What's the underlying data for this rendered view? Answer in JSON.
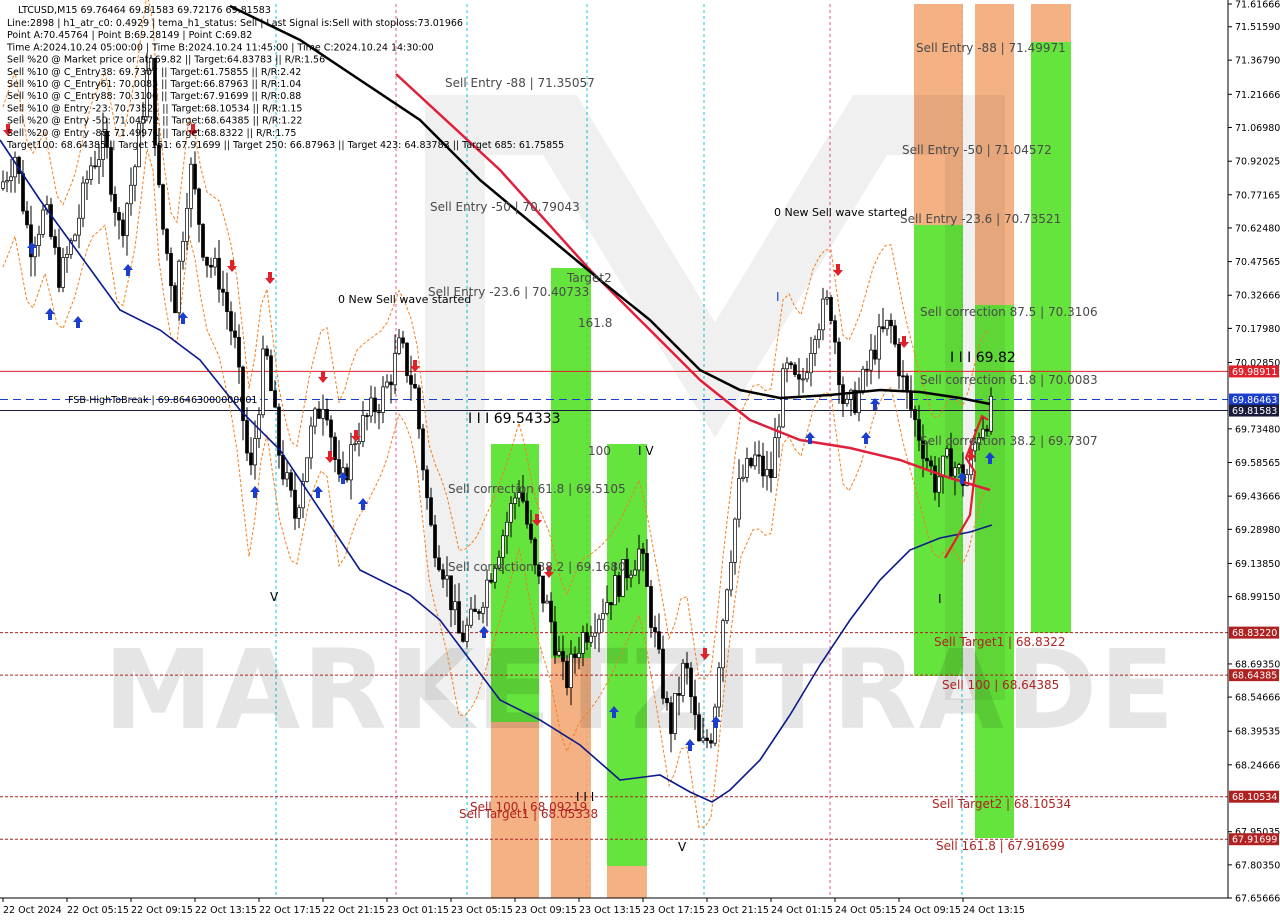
{
  "window": {
    "symbol_line": "LTCUSD,M15  69.76464 69.81583 69.72176 69.81583"
  },
  "info_lines": [
    "Line:2898 | h1_atr_c0: 0.4929 | tema_h1_status: Sell | Last Signal is:Sell with stoploss:73.01966",
    "Point A:70.45764 | Point B:69.28149 | Point C:69.82",
    "Time A:2024.10.24 05:00:00 | Time B:2024.10.24 11:45:00 | Time C:2024.10.24 14:30:00",
    "Sell %20 @ Market price or at: 69.82 || Target:64.83783 || R/R:1.56",
    "Sell %10 @ C_Entry38: 69.7307 || Target:61.75855 || R/R:2.42",
    "Sell %10 @ C_Entry61: 70.0083 || Target:66.87963 || R/R:1.04",
    "Sell %10 @ C_Entry88: 70.3106 || Target:67.91699 || R/R:0.88",
    "Sell %10 @ Entry -23: 70.73521 || Target:68.10534 || R/R:1.15",
    "Sell %20 @ Entry -50: 71.04572 || Target:68.64385 || R/R:1.22",
    "Sell %20 @ Entry -88: 71.49971 || Target:68.8322 || R/R:1.75",
    "Target100: 68.64385 || Target 161: 67.91699 || Target 250: 66.87963 || Target 423: 64.83783 || Target 685: 61.75855"
  ],
  "watermark": "MARKETZITRADE",
  "chart_data": {
    "type": "candlestick",
    "ylim": [
      67.65666,
      71.61666
    ],
    "x_ticks": [
      "22 Oct 2024",
      "22 Oct 05:15",
      "22 Oct 09:15",
      "22 Oct 13:15",
      "22 Oct 17:15",
      "22 Oct 21:15",
      "23 Oct 01:15",
      "23 Oct 05:15",
      "23 Oct 09:15",
      "23 Oct 13:15",
      "23 Oct 17:15",
      "23 Oct 21:15",
      "24 Oct 01:15",
      "24 Oct 05:15",
      "24 Oct 09:15",
      "24 Oct 13:15"
    ],
    "y_ticks": [
      71.61666,
      71.5159,
      71.3679,
      71.21666,
      71.0698,
      70.92025,
      70.77165,
      70.6248,
      70.47565,
      70.32666,
      70.1798,
      70.0285,
      69.7348,
      69.58565,
      69.43666,
      69.2898,
      69.1385,
      68.9915,
      68.6935,
      68.54666,
      68.39535,
      68.24666,
      67.95035,
      67.8035,
      67.65666
    ],
    "price_labels": [
      {
        "text": "69.98911",
        "value": 69.98911,
        "color": "#e0202a"
      },
      {
        "text": "69.86463",
        "value": 69.86463,
        "color": "#1a3fd0"
      },
      {
        "text": "69.81583",
        "value": 69.81583,
        "color": "#1a1a3a"
      },
      {
        "text": "68.83220",
        "value": 68.8322,
        "color": "#b02222"
      },
      {
        "text": "68.64385",
        "value": 68.64385,
        "color": "#b02222"
      },
      {
        "text": "68.10534",
        "value": 68.10534,
        "color": "#b02222"
      },
      {
        "text": "67.91699",
        "value": 67.91699,
        "color": "#b02222"
      }
    ],
    "horizontal_lines": [
      {
        "value": 69.98911,
        "color": "#e0202a",
        "style": "solid"
      },
      {
        "value": 69.86463,
        "color": "#1a3fd0",
        "style": "dashed"
      },
      {
        "value": 69.81583,
        "color": "#1a1a3a",
        "style": "solid"
      },
      {
        "value": 68.8322,
        "color": "#b02222",
        "style": "dotted"
      },
      {
        "value": 68.64385,
        "color": "#b02222",
        "style": "dotted"
      },
      {
        "value": 68.10534,
        "color": "#b02222",
        "style": "dotted"
      },
      {
        "value": 67.91699,
        "color": "#b02222",
        "style": "dotted"
      }
    ],
    "annotations": [
      {
        "text": "Sell Entry -88 | 71.35057",
        "value": 71.35057,
        "color": "#4a4a4a"
      },
      {
        "text": "Sell Entry -50 | 70.79043",
        "value": 70.79043,
        "color": "#4a4a4a"
      },
      {
        "text": "Sell Entry -23.6 | 70.40733",
        "value": 70.40733,
        "color": "#4a4a4a"
      },
      {
        "text": "0 New Sell wave started",
        "value": 70.38,
        "color": "#000000"
      },
      {
        "text": "FSB-HighToBreak | 69.86463000000001",
        "value": 69.86463,
        "color": "#000000"
      },
      {
        "text": "I I I 69.54333",
        "value": 69.75,
        "color": "#000000"
      },
      {
        "text": "Sell correction 61.8 | 69.5105",
        "value": 69.5105,
        "color": "#4a4a4a"
      },
      {
        "text": "Sell correction 38.2 | 69.1680",
        "value": 69.168,
        "color": "#4a4a4a"
      },
      {
        "text": "Sell 100 | 68.09219",
        "value": 68.09219,
        "color": "#b02222"
      },
      {
        "text": "Sell Target1 | 68.05338",
        "value": 68.05338,
        "color": "#b02222"
      },
      {
        "text": "0 New Sell wave started",
        "value": 70.76,
        "color": "#000000"
      },
      {
        "text": "Sell Entry -88 | 71.49971",
        "value": 71.49971,
        "color": "#4a4a4a"
      },
      {
        "text": "Sell Entry -50 | 71.04572",
        "value": 71.04572,
        "color": "#4a4a4a"
      },
      {
        "text": "Sell Entry -23.6 | 70.73521",
        "value": 70.73521,
        "color": "#4a4a4a"
      },
      {
        "text": "Sell correction 87.5 | 70.3106",
        "value": 70.3106,
        "color": "#4a4a4a"
      },
      {
        "text": "I I I 69.82",
        "value": 70.05,
        "color": "#000000"
      },
      {
        "text": "Sell correction 61.8 | 70.0083",
        "value": 70.0083,
        "color": "#4a4a4a"
      },
      {
        "text": "Sell correction 38.2 | 69.7307",
        "value": 69.7307,
        "color": "#4a4a4a"
      },
      {
        "text": "Sell Target1 | 68.8322",
        "value": 68.8322,
        "color": "#b02222"
      },
      {
        "text": "Sell 100 | 68.64385",
        "value": 68.64385,
        "color": "#b02222"
      },
      {
        "text": "Sell Target2 | 68.10534",
        "value": 68.10534,
        "color": "#b02222"
      },
      {
        "text": "Sell 161.8 | 67.91699",
        "value": 67.91699,
        "color": "#b02222"
      },
      {
        "text": "Target2",
        "value": 70.47,
        "color": "#4a4a4a"
      },
      {
        "text": "161.8",
        "value": 70.2,
        "color": "#4a4a4a"
      },
      {
        "text": "100",
        "value": 69.62,
        "color": "#4a4a4a"
      },
      {
        "text": "I V",
        "value": 69.62,
        "color": "#000000"
      },
      {
        "text": "V",
        "value": 68.97,
        "color": "#000000"
      },
      {
        "text": "V",
        "value": 67.83,
        "color": "#000000"
      },
      {
        "text": "I",
        "value": 70.33,
        "color": "#1a3fd0"
      },
      {
        "text": "I",
        "value": 68.97,
        "color": "#000000"
      },
      {
        "text": "I I I",
        "value": 68.1,
        "color": "#000000"
      }
    ],
    "colors": {
      "bull_fill": "#ffffff",
      "bear_fill": "#000000",
      "ma_red": "#e0203a",
      "ma_black": "#000000",
      "ma_navy": "#0a1a8a",
      "zone_green": "#4ee021",
      "zone_orange": "#f2a672",
      "sell_arrow": "#e0202a",
      "buy_arrow": "#1a3fd0"
    }
  }
}
